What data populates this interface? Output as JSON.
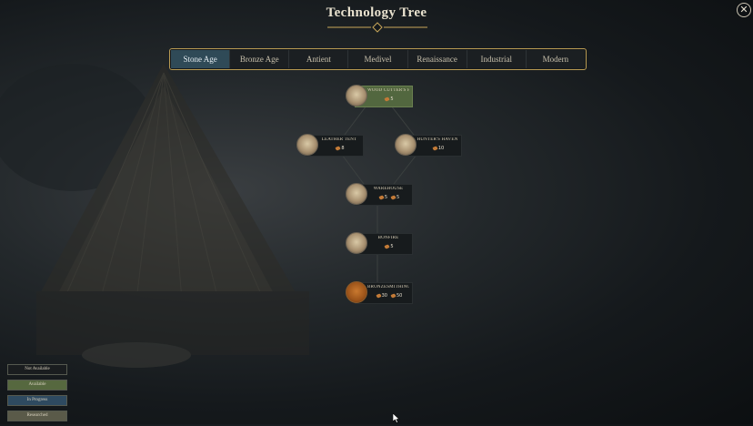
{
  "window": {
    "title": "Technology Tree",
    "close_label": "✕"
  },
  "tabs": [
    {
      "label": "Stone Age",
      "active": true
    },
    {
      "label": "Bronze Age",
      "active": false
    },
    {
      "label": "Antient",
      "active": false
    },
    {
      "label": "Medivel",
      "active": false
    },
    {
      "label": "Renaissance",
      "active": false
    },
    {
      "label": "Industrial",
      "active": false
    },
    {
      "label": "Modern",
      "active": false
    }
  ],
  "tech_nodes": [
    {
      "id": "wood-cutters-hut",
      "name": "WOOD CUTTER'S HUT",
      "status": "available",
      "icon": "hut-icon",
      "costs": [
        "5"
      ]
    },
    {
      "id": "leather-tent",
      "name": "LEATHER TENT",
      "status": "not-available",
      "icon": "tent-icon",
      "costs": [
        "8"
      ]
    },
    {
      "id": "hunters-haven",
      "name": "HUNTER'S HAVEN",
      "status": "not-available",
      "icon": "haven-icon",
      "costs": [
        "10"
      ]
    },
    {
      "id": "warehouse",
      "name": "WAREHOUSE",
      "status": "not-available",
      "icon": "warehouse-icon",
      "costs": [
        "5",
        "5"
      ]
    },
    {
      "id": "bonfire",
      "name": "BONFIRE",
      "status": "not-available",
      "icon": "bonfire-icon",
      "costs": [
        "5"
      ]
    },
    {
      "id": "bronzesmith",
      "name": "BRONZESMITHING",
      "status": "not-available",
      "icon": "bronze-icon",
      "costs": [
        "30",
        "50"
      ]
    }
  ],
  "legend": [
    {
      "label": "Not Available",
      "status": "not-available"
    },
    {
      "label": "Available",
      "status": "available"
    },
    {
      "label": "In Progress",
      "status": "in-progress"
    },
    {
      "label": "Researched",
      "status": "researched"
    }
  ],
  "colors": {
    "accent_gold": "#b89a52",
    "tab_active": "#2f4a57",
    "available": "#52673f",
    "in_progress": "#2e4a60",
    "researched": "#5a5a49",
    "resource": "#c27a37"
  }
}
